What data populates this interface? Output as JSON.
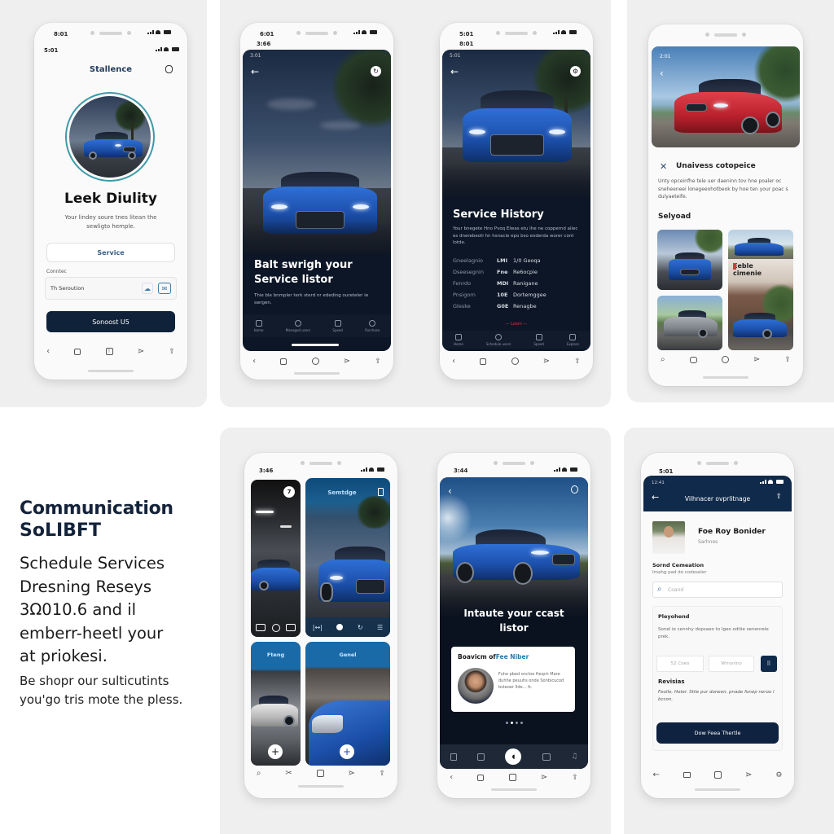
{
  "colors": {
    "navy": "#0f223a",
    "accent_blue": "#1e56a8",
    "teal_ring": "#3e9aa8",
    "panel_bg": "#efefef",
    "danger_red": "#d63a3a"
  },
  "phone1": {
    "status_time": "8:01",
    "status_time_secondary": "5:01",
    "brand": "Stallence",
    "title": "Leek Diulity",
    "subtitle": "Your lindey soure tnes litean the sewligto hemple.",
    "service_button": "Service",
    "field_label": "Conntec",
    "field_value": "Th Seroution",
    "primary_button": "Sonoost U5",
    "icons": [
      "cloud-icon",
      "mail-icon",
      "user-icon"
    ]
  },
  "phone2": {
    "status_time": "6:01",
    "status_time_secondary": "3:66",
    "screen_time": "3:01",
    "headline": "Balt swrigh your Service listor",
    "description": "Thie ble bnmpler terk sterd nr ededing oureteler ie swrgen.",
    "tabs": [
      {
        "label": "Home",
        "icon": "calendar-icon"
      },
      {
        "label": "Managed users",
        "icon": "circle-icon"
      },
      {
        "label": "Speed",
        "icon": "document-icon"
      },
      {
        "label": "Purchase",
        "icon": "power-icon"
      }
    ]
  },
  "phone3": {
    "status_time": "5:01",
    "status_time_secondary": "8:01",
    "screen_time": "5:01",
    "title": "Service History",
    "description": "Your bnegete Hno Pvoq Elwas etu lhe ne coppernd aliec es dnerebeoti hn hsnacie epo bso eoderda worer cont lotde.",
    "history": [
      {
        "label": "Gneelagnio",
        "code": "LMI",
        "value": "1/0 Geoqa"
      },
      {
        "label": "Dseesegnin",
        "code": "Fne",
        "value": "Re6ocpie"
      },
      {
        "label": "Fenrdo",
        "code": "MDI",
        "value": "Ranigane"
      },
      {
        "label": "Pnsigorn",
        "code": "10E",
        "value": "Dortemggee"
      },
      {
        "label": "Gleske",
        "code": "G0E",
        "value": "Renagbe"
      }
    ],
    "more_link": "Loom",
    "tabs": [
      {
        "label": "Home",
        "icon": "calendar-icon"
      },
      {
        "label": "Schedule users",
        "icon": "circle-icon"
      },
      {
        "label": "Speed",
        "icon": "document-icon"
      },
      {
        "label": "Explore",
        "icon": "home-icon"
      }
    ]
  },
  "phone4": {
    "screen_time": "2:01",
    "feature_title": "Unaivess cotopeice",
    "feature_text": "Unty opceinfhe tele uer daeninn tov hne poaler oc sneheeneei lonegeeohotbeok by hoe ten your poac s dulyaeteife.",
    "section_title": "Selyoad",
    "gallery_overlay_text": "Eeble cimenie"
  },
  "promo": {
    "heading_line1": "Communication",
    "heading_line2": "SoLIBFT",
    "body_lines": [
      "Schedule Services",
      "Dresning Reseys",
      "3Ω010.6 and il",
      "emberr-heetl your",
      "at priokesi."
    ],
    "small_lines": [
      "Be shopr our sulticutints",
      "you'go tris mote the pless."
    ]
  },
  "phone5": {
    "status_time": "3:46",
    "card_top_right_title": "Semtdge",
    "card_badge": "7",
    "card_bottom_left_title": "Fteng",
    "card_bottom_right_title": "Genel"
  },
  "phone6": {
    "status_time": "3:44",
    "headline": "Intaute your ccast listor",
    "review_title_prefix": "Boavicm of",
    "review_title_highlight": "Fee Niber",
    "review_text": "Fuhe pbed oncloe fteqch Mare duhhe peuuhs onde Sonbicucod bsteoer llde... tt.",
    "pager_dots": 4,
    "active_dot": 1
  },
  "phone7": {
    "status_time": "5:01",
    "screen_time": "12:41",
    "header_title": "Vilhnacer ovprlitnage",
    "provider_name": "Foe Roy Bonider",
    "provider_role": "Sarhnes",
    "section_title": "Sornd Cemeation",
    "section_subtitle": "Imahg pad do codeseler",
    "search_placeholder": "Coand",
    "card_title": "Pleyohend",
    "card_text": "Sonel ie cennhy dopsaeo to Igeo odtiie senenrele prek.",
    "input1_placeholder": "52 Coeo",
    "input2_placeholder": "Wrnsnlno",
    "reviews_title": "Revisias",
    "reviews_text": "Feolle, Hoter. Stile pur doneen, pnade fonep neroo l bccon.",
    "cta_button": "Dow Feea Thertle"
  }
}
